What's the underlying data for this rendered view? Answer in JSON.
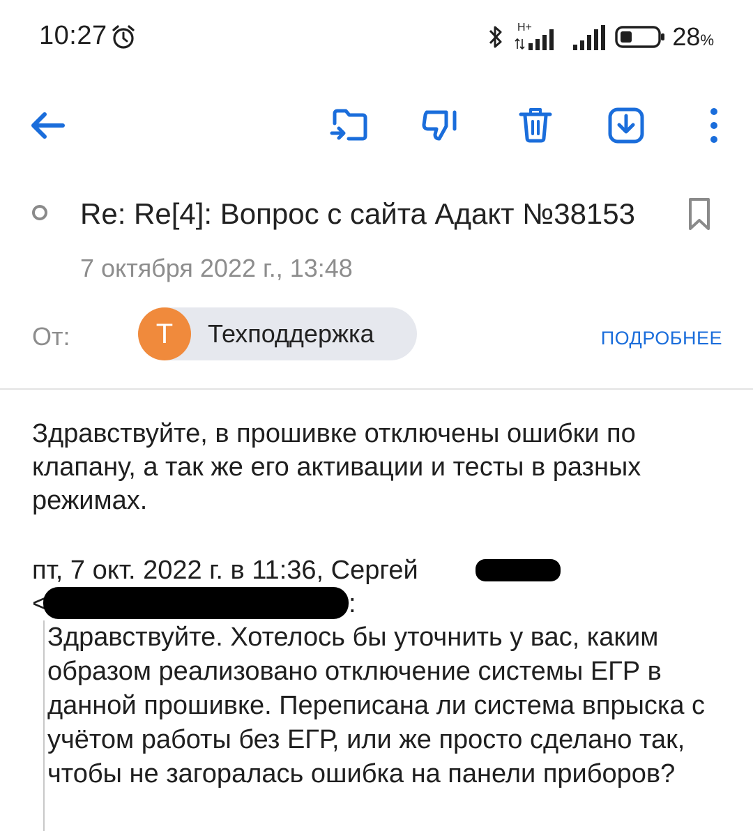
{
  "status_bar": {
    "time": "10:27",
    "network_type": "H+",
    "battery_percent": "28",
    "battery_unit": "%"
  },
  "toolbar": {
    "back_icon": "arrow-left-icon",
    "move_icon": "move-to-folder-icon",
    "spam_icon": "thumbs-down-icon",
    "delete_icon": "trash-icon",
    "archive_icon": "download-box-icon",
    "more_icon": "more-vertical-icon"
  },
  "message": {
    "subject": "Re: Re[4]: Вопрос с сайта Адакт №38153",
    "date": "7 октября 2022 г., 13:48",
    "from_label": "От:",
    "sender_initial": "Т",
    "sender_name": "Техподдержка",
    "details_link": "ПОДРОБНЕЕ",
    "body": "Здравствуйте, в прошивке отключены ошибки по клапану, а так же его активации и тесты в разных режимах.",
    "quote_header": "пт, 7 окт. 2022 г. в 11:36, Сергей",
    "quote_header_open": "<",
    "quote_header_colon": ":",
    "quoted_text": "Здравствуйте. Хотелось бы уточнить у вас, каким образом реализовано отключение системы ЕГР в данной прошивке. Переписана ли система впрыска с учётом работы без ЕГР, или же просто сделано так, чтобы не загоралась ошибка на панели приборов?"
  },
  "colors": {
    "accent": "#1a6ddb",
    "avatar": "#f08a3c",
    "chip_bg": "#e6e8ee",
    "muted_text": "#8d8d8d"
  }
}
